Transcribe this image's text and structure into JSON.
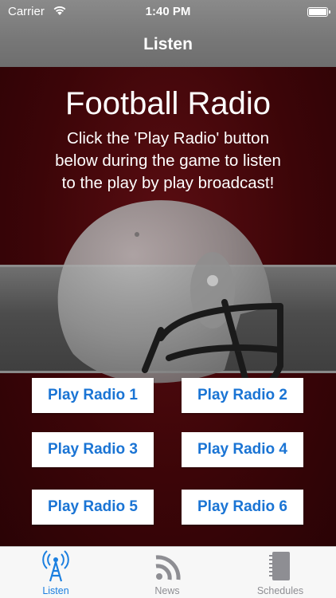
{
  "status_bar": {
    "carrier": "Carrier",
    "time": "1:40 PM"
  },
  "nav": {
    "title": "Listen"
  },
  "main": {
    "title": "Football Radio",
    "description": "Click the 'Play Radio' button below during the game to listen to the play by play broadcast!",
    "buttons": [
      "Play Radio 1",
      "Play Radio 2",
      "Play Radio 3",
      "Play Radio 4",
      "Play Radio 5",
      "Play Radio 6"
    ]
  },
  "tabs": [
    {
      "label": "Listen",
      "icon": "radio-tower-icon",
      "active": true
    },
    {
      "label": "News",
      "icon": "rss-icon",
      "active": false
    },
    {
      "label": "Schedules",
      "icon": "notebook-icon",
      "active": false
    }
  ],
  "colors": {
    "accent": "#1a74d4",
    "background": "#3c0508",
    "tab_active": "#1a7fe0"
  }
}
